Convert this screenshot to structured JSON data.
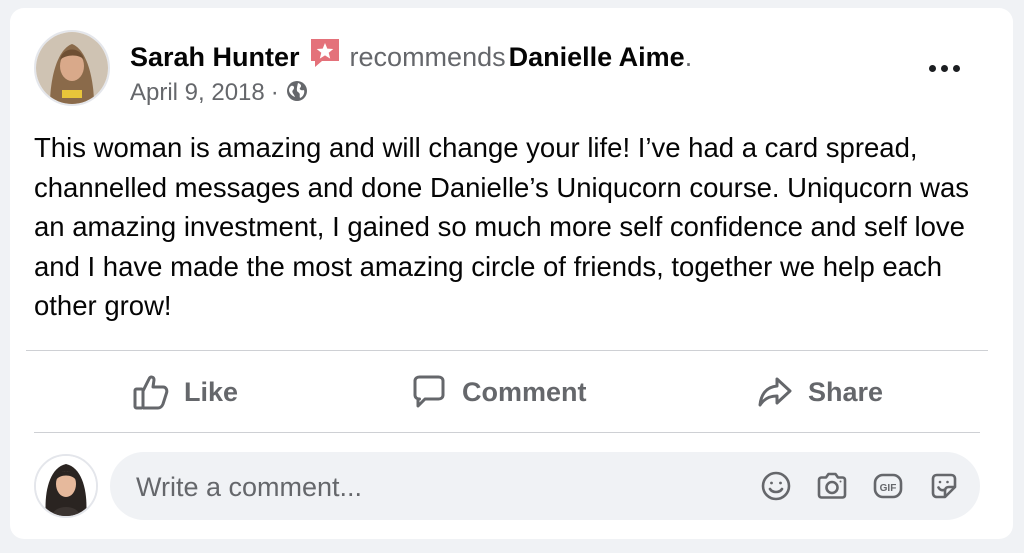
{
  "post": {
    "author": "Sarah Hunter",
    "verb": "recommends",
    "subject": "Danielle Aime",
    "date": "April 9, 2018",
    "separator": "·",
    "audience_icon": "globe-icon",
    "badge_icon": "recommend-star-icon",
    "body": "This woman is amazing and will change your life! I’ve had a card spread, channelled messages and done Danielle’s Uniqucorn course. Uniqucorn was an amazing investment, I gained so much more self confidence and self love and I have made the most amazing circle of friends, together we help each other grow!"
  },
  "actions": {
    "like": "Like",
    "comment": "Comment",
    "share": "Share"
  },
  "composer": {
    "placeholder": "Write a comment...",
    "icons": [
      "emoji-icon",
      "camera-icon",
      "gif-icon",
      "sticker-icon"
    ]
  },
  "colors": {
    "badge": "#e4717a",
    "secondary_text": "#65676b",
    "primary_text": "#050505",
    "composer_bg": "#f0f2f5"
  }
}
